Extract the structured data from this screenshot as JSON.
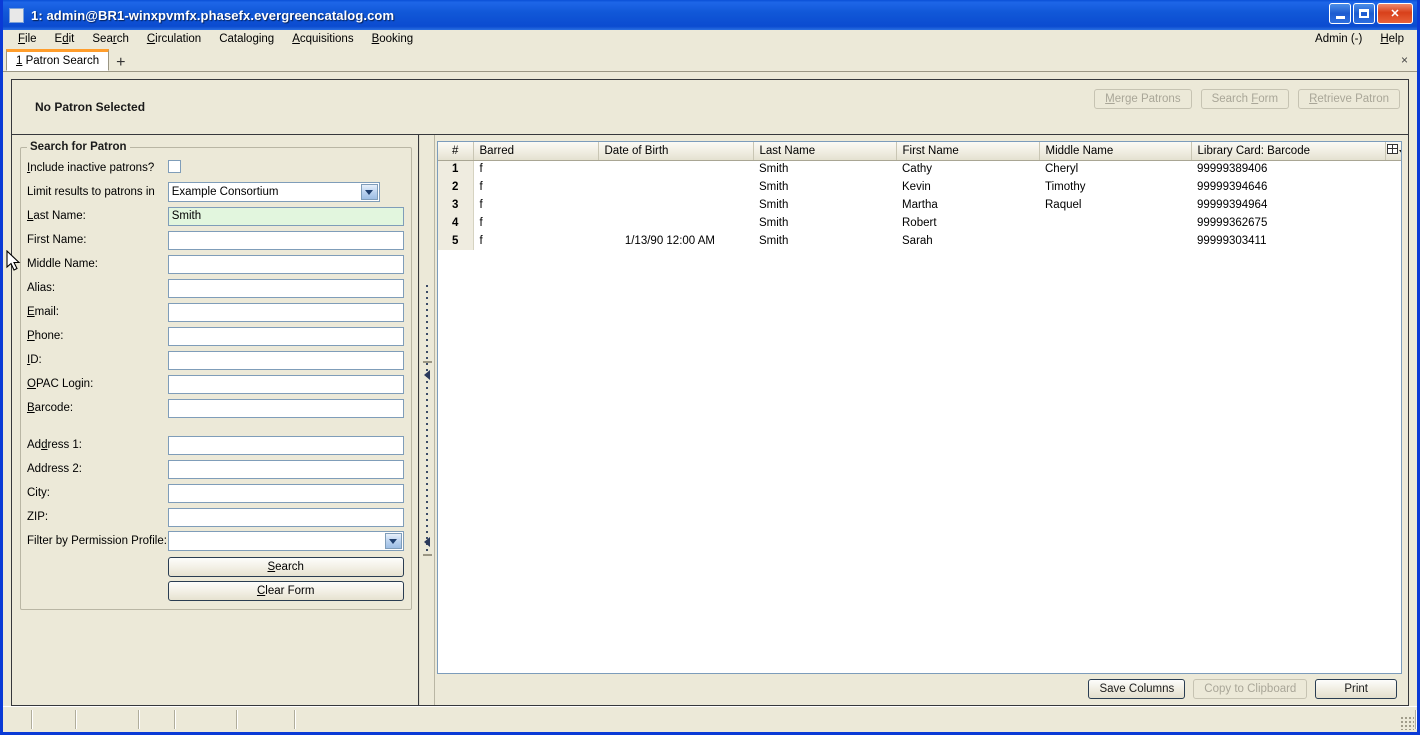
{
  "window": {
    "title": "1: admin@BR1-winxpvmfx.phasefx.evergreencatalog.com",
    "minimize_label": "Minimize",
    "maximize_label": "Maximize",
    "close_label": "✕"
  },
  "menubar": {
    "items": [
      {
        "label": "File",
        "accel": "F"
      },
      {
        "label": "Edit",
        "accel": "E"
      },
      {
        "label": "Search",
        "accel": "r"
      },
      {
        "label": "Circulation",
        "accel": "C"
      },
      {
        "label": "Cataloging",
        "accel": "g"
      },
      {
        "label": "Acquisitions",
        "accel": "A"
      },
      {
        "label": "Booking",
        "accel": "B"
      }
    ],
    "right": [
      {
        "label": "Admin (-)"
      },
      {
        "label": "Help",
        "accel": "H"
      }
    ]
  },
  "tabs": {
    "active": {
      "index": "1",
      "label": "Patron Search"
    },
    "new_tab_label": "+",
    "close_label": "×"
  },
  "patron_bar": {
    "status": "No Patron Selected",
    "buttons": [
      {
        "label": "Merge Patrons",
        "disabled": true
      },
      {
        "label": "Search Form",
        "disabled": true
      },
      {
        "label": "Retrieve Patron",
        "disabled": true
      }
    ]
  },
  "search_form": {
    "legend": "Search for Patron",
    "include_inactive_label": "Include inactive patrons?",
    "include_inactive_checked": false,
    "limit_label": "Limit results to patrons in",
    "limit_value": "Example Consortium",
    "fields": [
      {
        "label": "Last Name:",
        "value": "Smith",
        "focused": true
      },
      {
        "label": "First Name:",
        "value": "",
        "focused": false
      },
      {
        "label": "Middle Name:",
        "value": "",
        "focused": false
      },
      {
        "label": "Alias:",
        "value": "",
        "focused": false
      },
      {
        "label": "Email:",
        "value": "",
        "focused": false
      },
      {
        "label": "Phone:",
        "value": "",
        "focused": false
      },
      {
        "label": "ID:",
        "value": "",
        "focused": false
      },
      {
        "label": "OPAC Login:",
        "value": "",
        "focused": false
      },
      {
        "label": "Barcode:",
        "value": "",
        "focused": false
      }
    ],
    "address_fields": [
      {
        "label": "Address 1:",
        "value": ""
      },
      {
        "label": "Address 2:",
        "value": ""
      },
      {
        "label": "City:",
        "value": ""
      },
      {
        "label": "ZIP:",
        "value": ""
      }
    ],
    "permission_label": "Filter by Permission Profile:",
    "permission_value": "",
    "search_button": "Search",
    "clear_button": "Clear Form"
  },
  "results": {
    "columns": [
      "#",
      "Barred",
      "Date of Birth",
      "Last Name",
      "First Name",
      "Middle Name",
      "Library Card: Barcode"
    ],
    "column_picker_label": "column-picker",
    "rows": [
      {
        "num": "1",
        "barred": "f",
        "dob": "",
        "last": "Smith",
        "first": "Cathy",
        "middle": "Cheryl",
        "barcode": "99999389406"
      },
      {
        "num": "2",
        "barred": "f",
        "dob": "",
        "last": "Smith",
        "first": "Kevin",
        "middle": "Timothy",
        "barcode": "99999394646"
      },
      {
        "num": "3",
        "barred": "f",
        "dob": "",
        "last": "Smith",
        "first": "Martha",
        "middle": "Raquel",
        "barcode": "99999394964"
      },
      {
        "num": "4",
        "barred": "f",
        "dob": "",
        "last": "Smith",
        "first": "Robert",
        "middle": "",
        "barcode": "99999362675"
      },
      {
        "num": "5",
        "barred": "f",
        "dob": "1/13/90 12:00 AM",
        "last": "Smith",
        "first": "Sarah",
        "middle": "",
        "barcode": "99999303411"
      }
    ],
    "actions": [
      {
        "label": "Save Columns",
        "disabled": false
      },
      {
        "label": "Copy to Clipboard",
        "disabled": true
      },
      {
        "label": "Print",
        "disabled": false
      }
    ]
  },
  "colors": {
    "titlebar": "#0b4bd0",
    "chrome": "#ece9d8",
    "active_tab_accent": "#ff9d2b",
    "field_focus": "#e2f6de",
    "field_border": "#7f9db9"
  }
}
